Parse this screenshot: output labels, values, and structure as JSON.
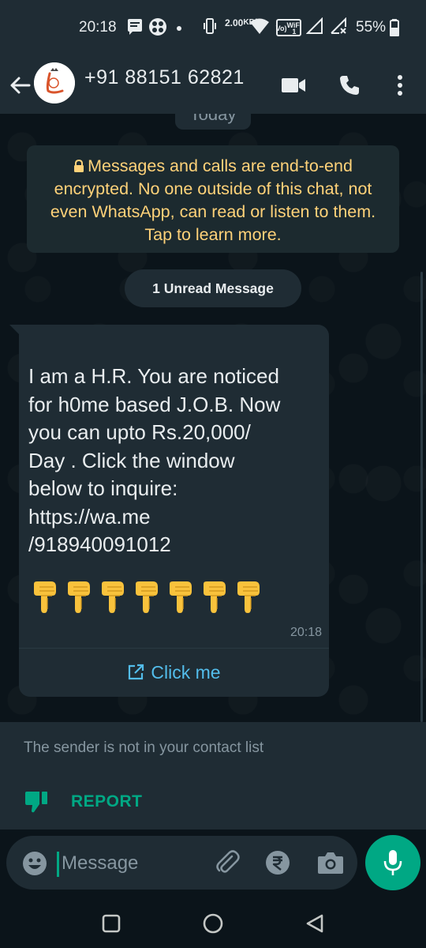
{
  "status_bar": {
    "time": "20:18",
    "net_speed_value": "2.00",
    "net_speed_unit": "KB/S",
    "vowifi_top": "Vo)",
    "vowifi_bottom": "WiFi 1",
    "battery": "55%"
  },
  "header": {
    "contact": "+91 88151 62821",
    "icons": [
      "back-arrow-icon",
      "video-call-icon",
      "phone-icon",
      "more-vertical-icon"
    ]
  },
  "chat": {
    "date_chip": "Today",
    "encryption_notice": "Messages and calls are end-to-end encrypted. No one outside of this chat, not even WhatsApp, can read or listen to them. Tap to learn more.",
    "unread_chip": "1 Unread Message",
    "message": {
      "text": "I am a H.R. You are noticed\nfor h0me based J.O.B. Now\nyou can upto Rs.20,000/\nDay . Click the window\nbelow to inquire:\nhttps://wa.me\n/918940091012",
      "emoji": "👇",
      "emoji_count": 7,
      "time": "20:18",
      "button_label": "Click me"
    }
  },
  "unknown_sender": {
    "notice": "The sender is not in your contact list",
    "report_label": "REPORT"
  },
  "input": {
    "placeholder": "Message"
  },
  "colors": {
    "accent": "#00a884",
    "link": "#53bdeb",
    "notice_text": "#ffd279",
    "bubble": "#1f2c34",
    "background": "#0b141a"
  }
}
